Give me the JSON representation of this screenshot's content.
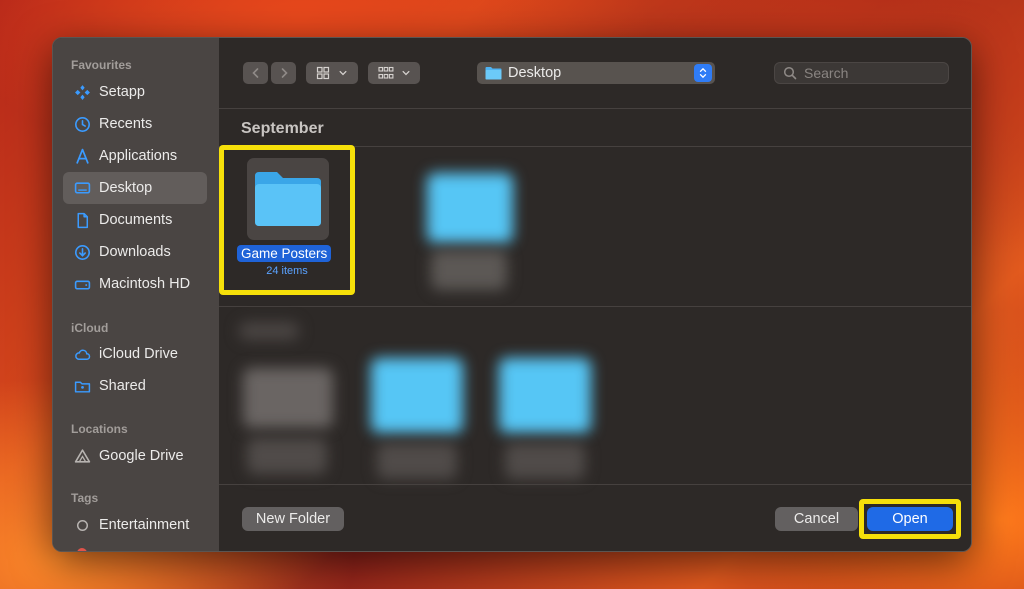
{
  "sidebar": {
    "sections": [
      {
        "title": "Favourites",
        "items": [
          {
            "label": "Setapp",
            "icon": "setapp-icon"
          },
          {
            "label": "Recents",
            "icon": "clock-icon"
          },
          {
            "label": "Applications",
            "icon": "applications-icon"
          },
          {
            "label": "Desktop",
            "icon": "desktop-icon",
            "active": true
          },
          {
            "label": "Documents",
            "icon": "document-icon"
          },
          {
            "label": "Downloads",
            "icon": "download-icon"
          },
          {
            "label": "Macintosh HD",
            "icon": "hard-drive-icon"
          }
        ]
      },
      {
        "title": "iCloud",
        "items": [
          {
            "label": "iCloud Drive",
            "icon": "cloud-icon"
          },
          {
            "label": "Shared",
            "icon": "shared-folder-icon"
          }
        ]
      },
      {
        "title": "Locations",
        "items": [
          {
            "label": "Google Drive",
            "icon": "google-drive-icon"
          }
        ]
      },
      {
        "title": "Tags",
        "items": [
          {
            "label": "Entertainment",
            "icon": "tag-circle-icon"
          }
        ]
      }
    ]
  },
  "toolbar": {
    "location": "Desktop",
    "search_placeholder": "Search"
  },
  "content": {
    "group_title": "September",
    "selected_item": {
      "name": "Game Posters",
      "subtitle": "24 items"
    }
  },
  "footer": {
    "new_folder_label": "New Folder",
    "cancel_label": "Cancel",
    "open_label": "Open"
  },
  "colors": {
    "accent": "#1f6ae6",
    "highlight": "#f6e00a",
    "folder": "#5ac3f7"
  }
}
